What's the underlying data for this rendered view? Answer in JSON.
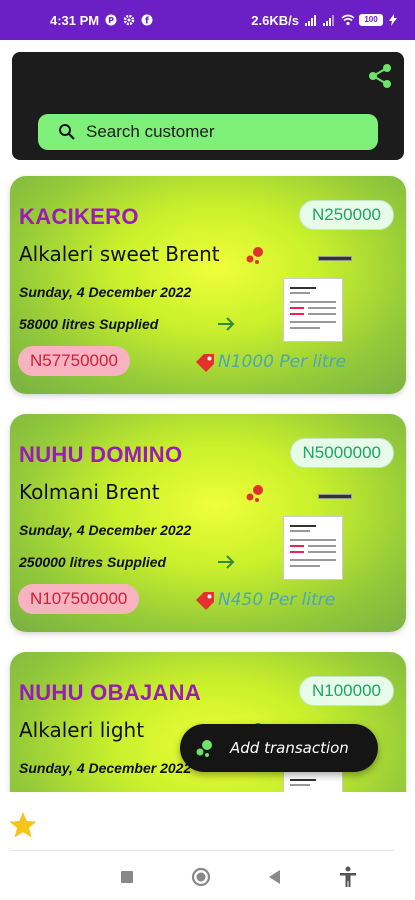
{
  "status_bar": {
    "time": "4:31 PM",
    "network_speed": "2.6KB/s",
    "battery": "100"
  },
  "search": {
    "placeholder": "Search customer"
  },
  "customers": [
    {
      "name": "KACIKERO",
      "total": "N250000",
      "product": "Alkaleri sweet Brent",
      "date": "Sunday, 4 December 2022",
      "supplied": "58000 litres Supplied",
      "amount": "N57750000",
      "price": "N1000 Per litre"
    },
    {
      "name": "NUHU DOMINO",
      "total": "N5000000",
      "product": "Kolmani Brent",
      "date": "Sunday, 4 December 2022",
      "supplied": "250000 litres Supplied",
      "amount": "N107500000",
      "price": "N450 Per litre"
    },
    {
      "name": "NUHU OBAJANA",
      "total": "N100000",
      "product": "Alkaleri light",
      "date": "Sunday, 4 December 2022",
      "supplied": "",
      "amount": "",
      "price": ""
    }
  ],
  "fab": {
    "label": "Add transaction"
  },
  "colors": {
    "status_bar": "#6b1fc4",
    "accent_green": "#7ef07a",
    "name_purple": "#9b1bb6",
    "amount_red": "#d21d3c"
  }
}
